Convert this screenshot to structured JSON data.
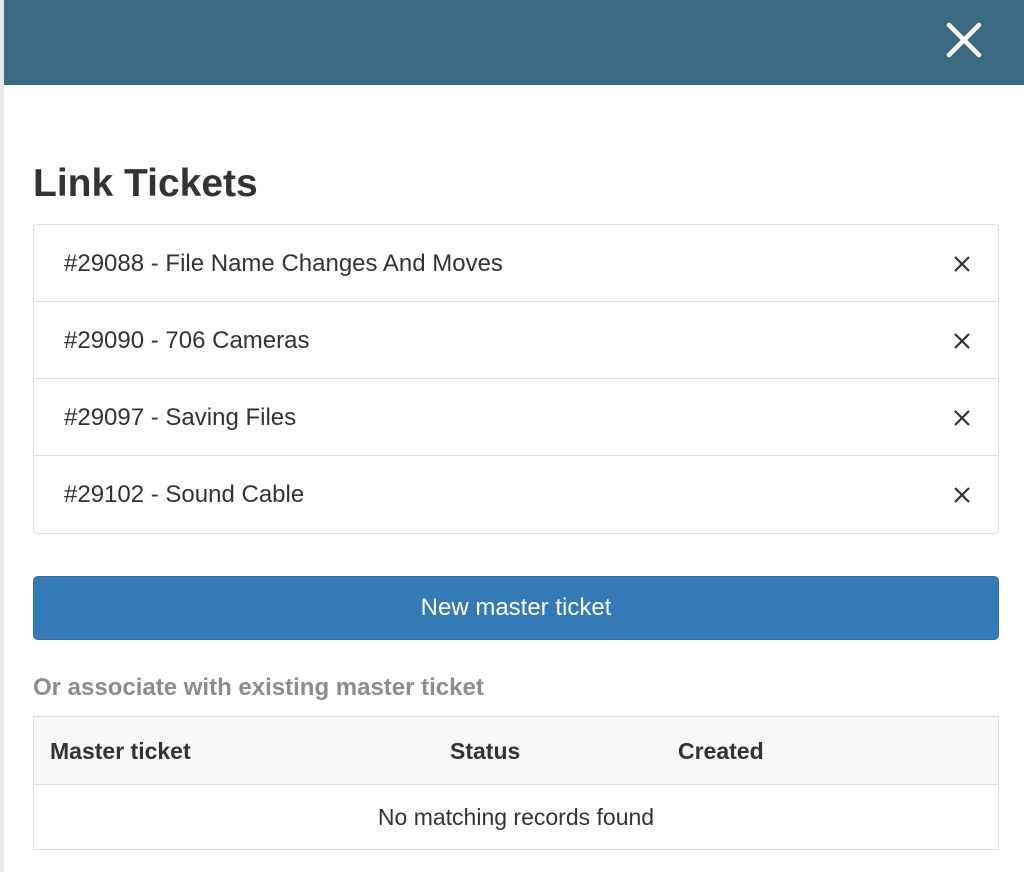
{
  "header": {
    "close_icon": "close-icon",
    "color": "#3b6981"
  },
  "dialog": {
    "title": "Link Tickets"
  },
  "tickets": [
    {
      "label": "#29088 - File Name Changes And Moves",
      "remove_icon": "close-icon"
    },
    {
      "label": "#29090 - 706 Cameras",
      "remove_icon": "close-icon"
    },
    {
      "label": "#29097 - Saving Files",
      "remove_icon": "close-icon"
    },
    {
      "label": "#29102 - Sound Cable",
      "remove_icon": "close-icon"
    }
  ],
  "new_master_button": {
    "label": "New master ticket",
    "color": "#337ab7"
  },
  "existing": {
    "heading": "Or associate with existing master ticket",
    "columns": [
      "Master ticket",
      "Status",
      "Created"
    ],
    "empty_message": "No matching records found"
  }
}
